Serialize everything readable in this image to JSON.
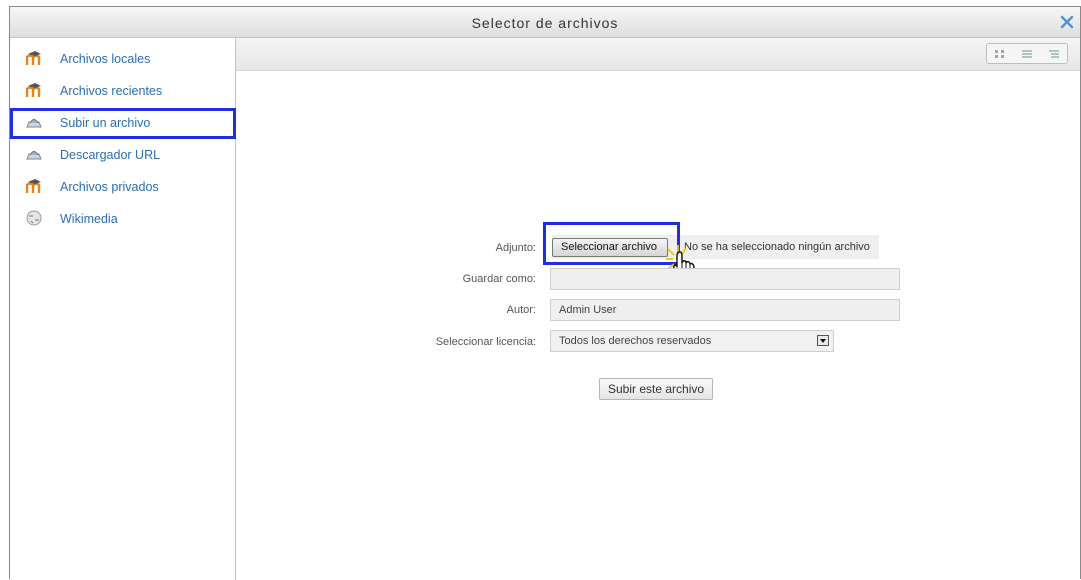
{
  "window": {
    "title": "Selector de archivos",
    "close_icon": "close-icon"
  },
  "sidebar": {
    "items": [
      {
        "label": "Archivos locales",
        "icon": "moodle-icon"
      },
      {
        "label": "Archivos recientes",
        "icon": "moodle-icon"
      },
      {
        "label": "Subir un archivo",
        "icon": "upload-icon",
        "selected": true
      },
      {
        "label": "Descargador URL",
        "icon": "upload-icon"
      },
      {
        "label": "Archivos privados",
        "icon": "moodle-icon"
      },
      {
        "label": "Wikimedia",
        "icon": "wikipedia-globe-icon"
      }
    ]
  },
  "toolbar": {
    "view_modes": [
      "icons-view-icon",
      "details-view-icon",
      "tree-view-icon"
    ]
  },
  "form": {
    "attachment_label": "Adjunto:",
    "choose_file_button": "Seleccionar archivo",
    "no_file_text": "No se ha seleccionado ningún archivo",
    "save_as_label": "Guardar como:",
    "save_as_value": "",
    "author_label": "Autor:",
    "author_value": "Admin User",
    "license_label": "Seleccionar licencia:",
    "license_value": "Todos los derechos reservados",
    "upload_button": "Subir este archivo"
  },
  "colors": {
    "link": "#2a6eb4",
    "highlight": "#1f2ee0"
  }
}
